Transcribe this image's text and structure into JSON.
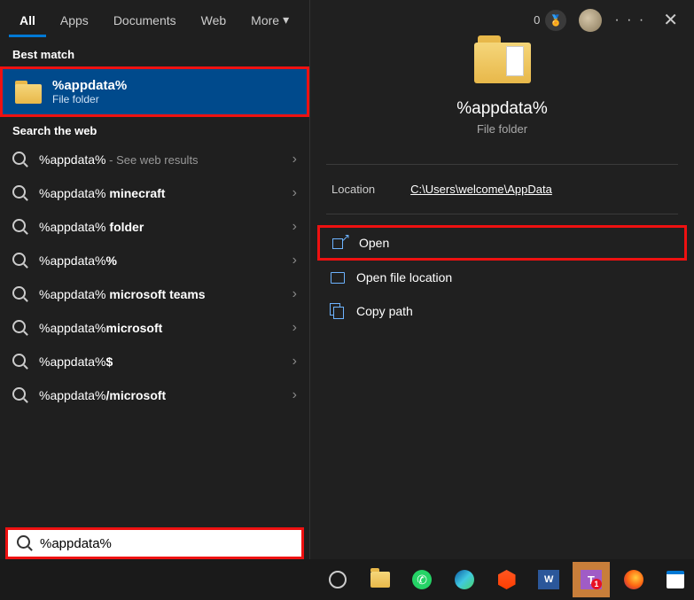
{
  "tabs": {
    "all": "All",
    "apps": "Apps",
    "documents": "Documents",
    "web": "Web",
    "more": "More"
  },
  "top": {
    "count": "0",
    "dots": "· · ·",
    "close": "✕"
  },
  "sections": {
    "best_match": "Best match",
    "search_web": "Search the web"
  },
  "best_match": {
    "title": "%appdata%",
    "subtitle": "File folder"
  },
  "web_results": [
    {
      "prefix": "%appdata%",
      "suffix": "",
      "hint": " - See web results"
    },
    {
      "prefix": "%appdata% ",
      "suffix": "minecraft",
      "hint": ""
    },
    {
      "prefix": "%appdata% ",
      "suffix": "folder",
      "hint": ""
    },
    {
      "prefix": "%appdata%",
      "suffix": "%",
      "hint": ""
    },
    {
      "prefix": "%appdata% ",
      "suffix": "microsoft teams",
      "hint": ""
    },
    {
      "prefix": "%appdata%",
      "suffix": "microsoft",
      "hint": ""
    },
    {
      "prefix": "%appdata%",
      "suffix": "$",
      "hint": ""
    },
    {
      "prefix": "%appdata%",
      "suffix": "/microsoft",
      "hint": ""
    }
  ],
  "preview": {
    "title": "%appdata%",
    "subtitle": "File folder",
    "location_label": "Location",
    "location_value": "C:\\Users\\welcome\\AppData",
    "actions": {
      "open": "Open",
      "open_loc": "Open file location",
      "copy": "Copy path"
    }
  },
  "search_input": "%appdata%",
  "taskbar": {
    "word": "W",
    "teams": "T",
    "teams_badge": "1"
  }
}
